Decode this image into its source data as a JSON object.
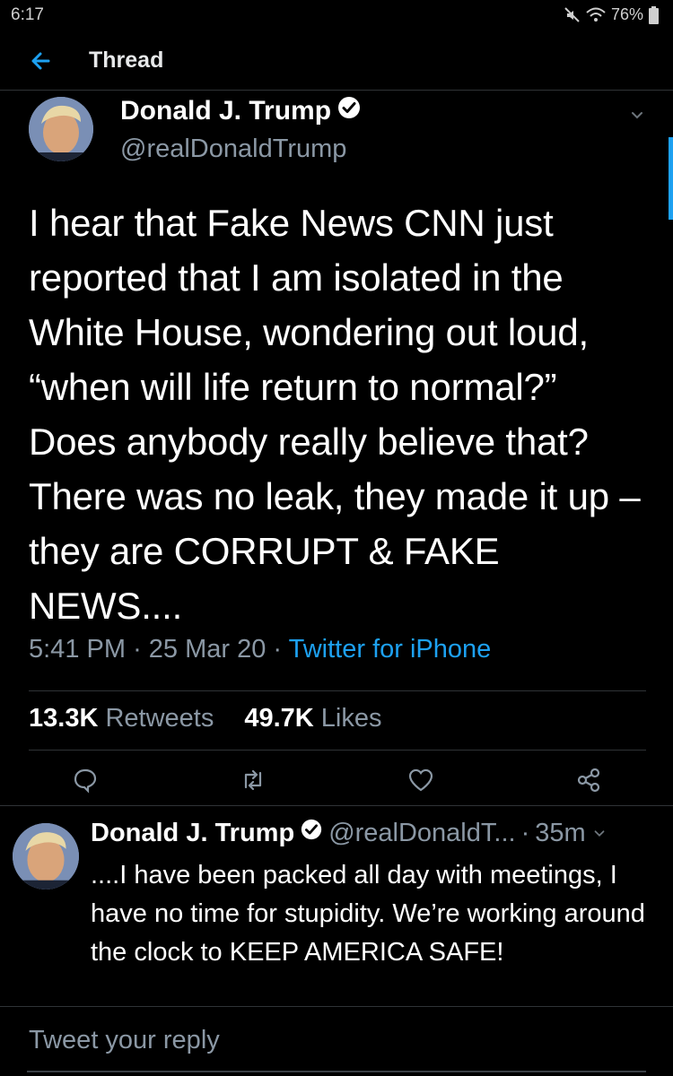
{
  "status_bar": {
    "time": "6:17",
    "battery": "76%"
  },
  "header": {
    "title": "Thread"
  },
  "main_tweet": {
    "name": "Donald J. Trump",
    "handle": "@realDonaldTrump",
    "text": "I hear that Fake News CNN just reported that I am isolated in the White House, wondering out loud, “when will life return to normal?” Does anybody really believe that? There was no leak, they made it up – they are CORRUPT & FAKE NEWS....",
    "time": "5:41 PM",
    "date": "25 Mar 20",
    "source": "Twitter for iPhone",
    "retweets_count": "13.3K",
    "retweets_label": "Retweets",
    "likes_count": "49.7K",
    "likes_label": "Likes"
  },
  "reply_tweet": {
    "name": "Donald J. Trump",
    "handle": "@realDonaldT...",
    "age": "35m",
    "text": "....I have been packed all day with meetings, I have no time for stupidity. We’re working around the clock to KEEP AMERICA SAFE!"
  },
  "reply_bar": {
    "placeholder": "Tweet your reply"
  },
  "colors": {
    "accent": "#1da1f2",
    "muted": "#8b98a5",
    "background": "#000000",
    "divider": "#2f3336"
  },
  "icons": [
    "mute-icon",
    "wifi-icon",
    "battery-icon",
    "back-arrow-icon",
    "verified-badge-icon",
    "chevron-down-icon",
    "reply-icon",
    "retweet-icon",
    "like-icon",
    "share-icon"
  ]
}
